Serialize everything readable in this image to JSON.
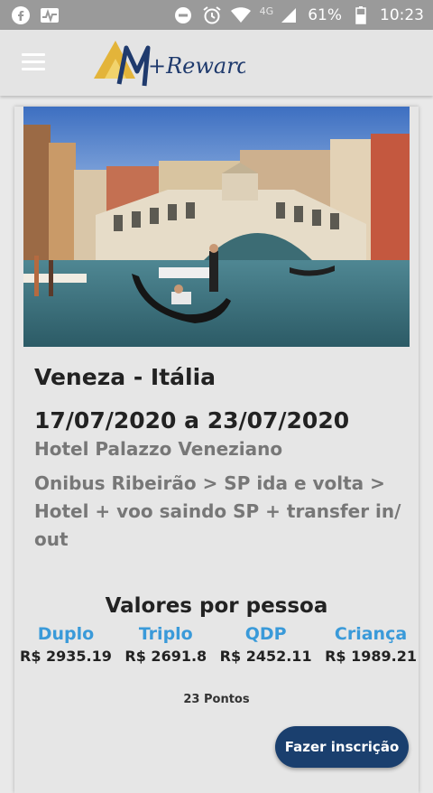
{
  "status_bar": {
    "left_icons": [
      "facebook-icon",
      "activity-icon"
    ],
    "battery_percent": "61%",
    "network": "4G",
    "time": "10:23"
  },
  "app_bar": {
    "logo_text": "M+Rewards",
    "menu_icon": "hamburger-menu-icon"
  },
  "trip": {
    "title": "Veneza - Itália",
    "dates": "17/07/2020 a 23/07/2020",
    "hotel": "Hotel Palazzo  Veneziano",
    "description": "Onibus Ribeirão > SP ida e volta > Hotel + voo saindo SP + transfer in/ out"
  },
  "prices": {
    "title": "Valores por pessoa",
    "items": [
      {
        "label": "Duplo",
        "value": "R$ 2935.19"
      },
      {
        "label": "Triplo",
        "value": "R$ 2691.8"
      },
      {
        "label": "QDP",
        "value": "R$ 2452.11"
      },
      {
        "label": "Criança",
        "value": "R$ 1989.21"
      }
    ]
  },
  "points": "23 Pontos",
  "cta_label": "Fazer inscrição",
  "colors": {
    "accent_blue": "#3a9ad9",
    "button": "#1a3f6e",
    "status_bar": "#9a9a9a"
  }
}
